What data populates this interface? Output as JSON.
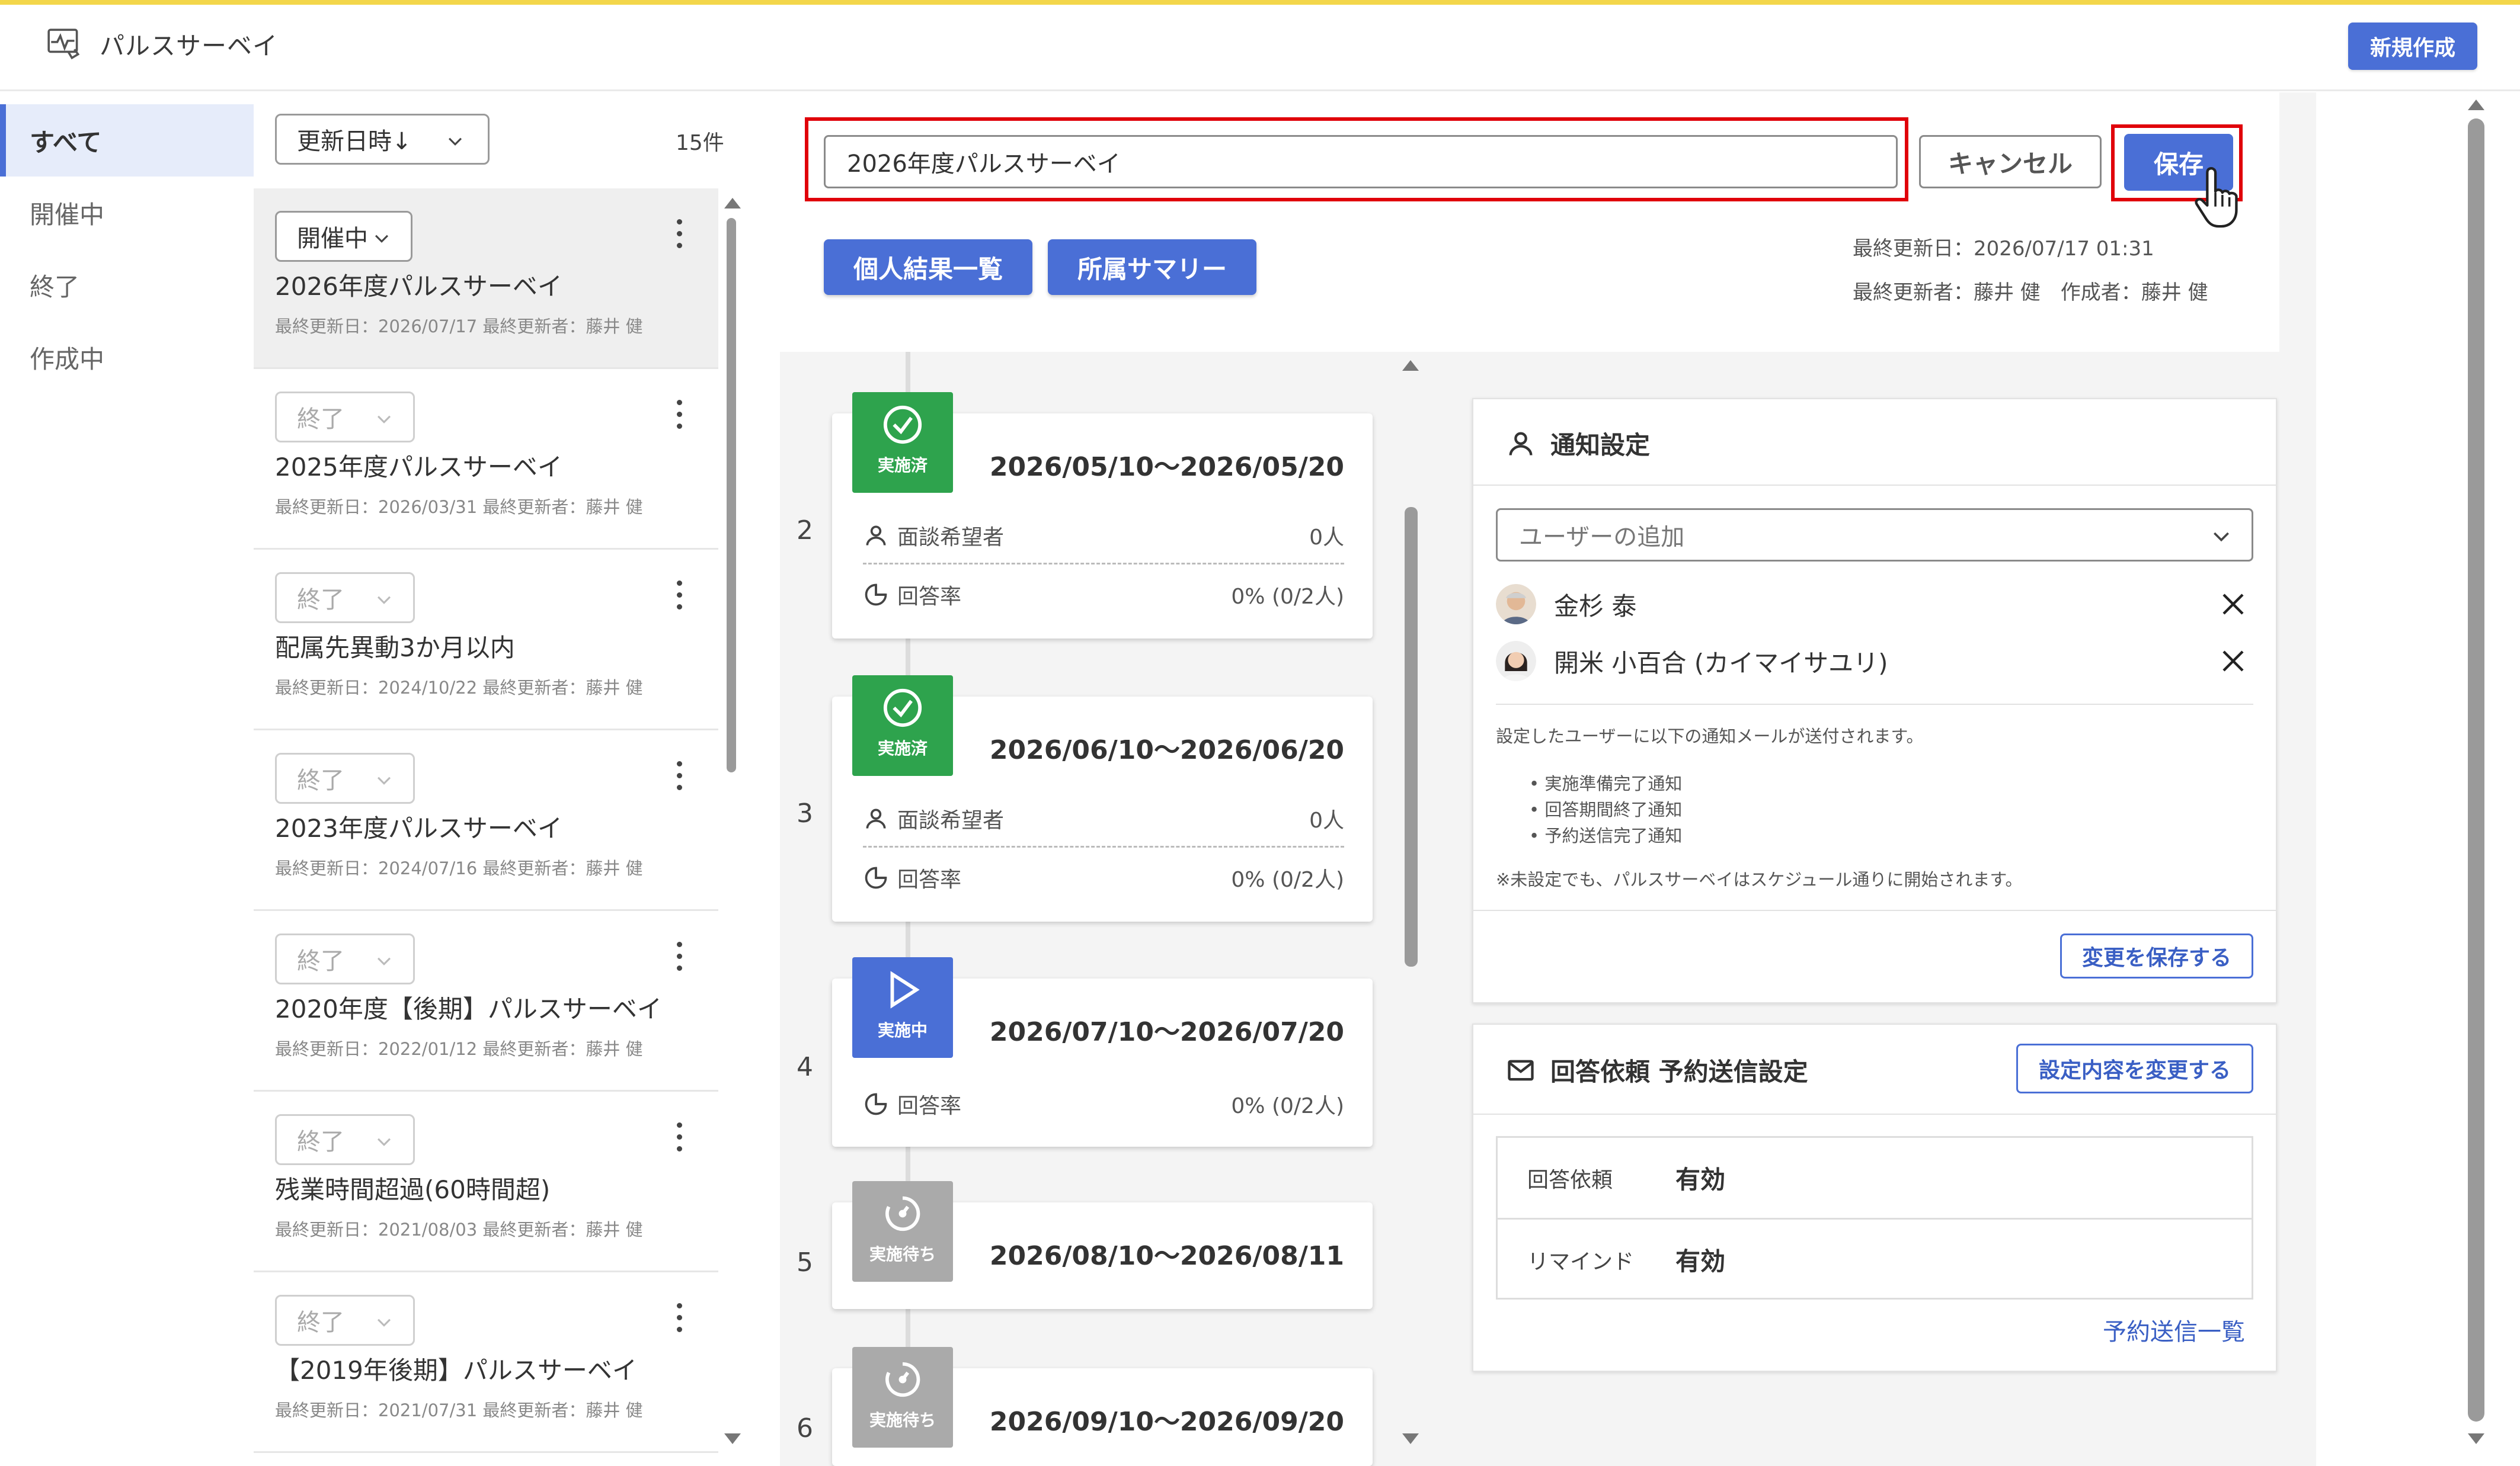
{
  "app": {
    "title": "パルスサーベイ",
    "new_button": "新規作成"
  },
  "filters": [
    {
      "label": "すべて",
      "active": true
    },
    {
      "label": "開催中",
      "active": false
    },
    {
      "label": "終了",
      "active": false
    },
    {
      "label": "作成中",
      "active": false
    }
  ],
  "list": {
    "sort_label": "更新日時↓",
    "count": "15件",
    "items": [
      {
        "status": "開催中",
        "title": "2026年度パルスサーベイ",
        "meta": "最終更新日：2026/07/17  最終更新者：藤井 健"
      },
      {
        "status": "終了",
        "title": "2025年度パルスサーベイ",
        "meta": "最終更新日：2026/03/31  最終更新者：藤井 健"
      },
      {
        "status": "終了",
        "title": "配属先異動3か月以内",
        "meta": "最終更新日：2024/10/22  最終更新者：藤井 健"
      },
      {
        "status": "終了",
        "title": "2023年度パルスサーベイ",
        "meta": "最終更新日：2024/07/16  最終更新者：藤井 健"
      },
      {
        "status": "終了",
        "title": "2020年度【後期】パルスサーベイ",
        "meta": "最終更新日：2022/01/12  最終更新者：藤井 健"
      },
      {
        "status": "終了",
        "title": "残業時間超過(60時間超)",
        "meta": "最終更新日：2021/08/03  最終更新者：藤井 健"
      },
      {
        "status": "終了",
        "title": "【2019年後期】パルスサーベイ",
        "meta": "最終更新日：2021/07/31  最終更新者：藤井 健"
      }
    ]
  },
  "detail": {
    "name_value": "2026年度パルスサーベイ",
    "cancel_label": "キャンセル",
    "save_label": "保存",
    "tabs": [
      "個人結果一覧",
      "所属サマリー"
    ],
    "last_updated": "最終更新日：2026/07/17 01:31",
    "updated_by": "最終更新者：藤井 健　作成者：藤井 健"
  },
  "timeline": [
    {
      "num": "2",
      "badge": "実施済",
      "state": "done",
      "date": "2026/05/10～2026/05/20",
      "rows": [
        {
          "label": "面談希望者",
          "value": "0人",
          "icon": "user-icon"
        },
        {
          "label": "回答率",
          "value": "0% (0/2人)",
          "icon": "pie-chart-icon"
        }
      ]
    },
    {
      "num": "3",
      "badge": "実施済",
      "state": "done",
      "date": "2026/06/10～2026/06/20",
      "rows": [
        {
          "label": "面談希望者",
          "value": "0人",
          "icon": "user-icon"
        },
        {
          "label": "回答率",
          "value": "0% (0/2人)",
          "icon": "pie-chart-icon"
        }
      ]
    },
    {
      "num": "4",
      "badge": "実施中",
      "state": "active",
      "date": "2026/07/10～2026/07/20",
      "rows": [
        {
          "label": "回答率",
          "value": "0% (0/2人)",
          "icon": "pie-chart-icon"
        }
      ]
    },
    {
      "num": "5",
      "badge": "実施待ち",
      "state": "wait",
      "date": "2026/08/10～2026/08/11",
      "rows": []
    },
    {
      "num": "6",
      "badge": "実施待ち",
      "state": "wait",
      "date": "2026/09/10～2026/09/20",
      "rows": []
    }
  ],
  "notify": {
    "title": "通知設定",
    "user_placeholder": "ユーザーの追加",
    "users": [
      "金杉 泰",
      "開米 小百合 (カイマイサユリ)"
    ],
    "desc": "設定したユーザーに以下の通知メールが送付されます。",
    "bullets": [
      "実施準備完了通知",
      "回答期間終了通知",
      "予約送信完了通知"
    ],
    "footnote": "※未設定でも、パルスサーベイはスケジュール通りに開始されます。",
    "save_changes": "変更を保存する"
  },
  "reservation": {
    "title": "回答依頼 予約送信設定",
    "change_button": "設定内容を変更する",
    "rows": [
      {
        "key": "回答依頼",
        "value": "有効"
      },
      {
        "key": "リマインド",
        "value": "有効"
      }
    ],
    "link": "予約送信一覧"
  },
  "colors": {
    "primary": "#4a6fd6",
    "done_green": "#2ea34d",
    "wait_gray": "#aaaaaa",
    "highlight_red": "#e0000a",
    "top_accent": "#f3d64b"
  }
}
